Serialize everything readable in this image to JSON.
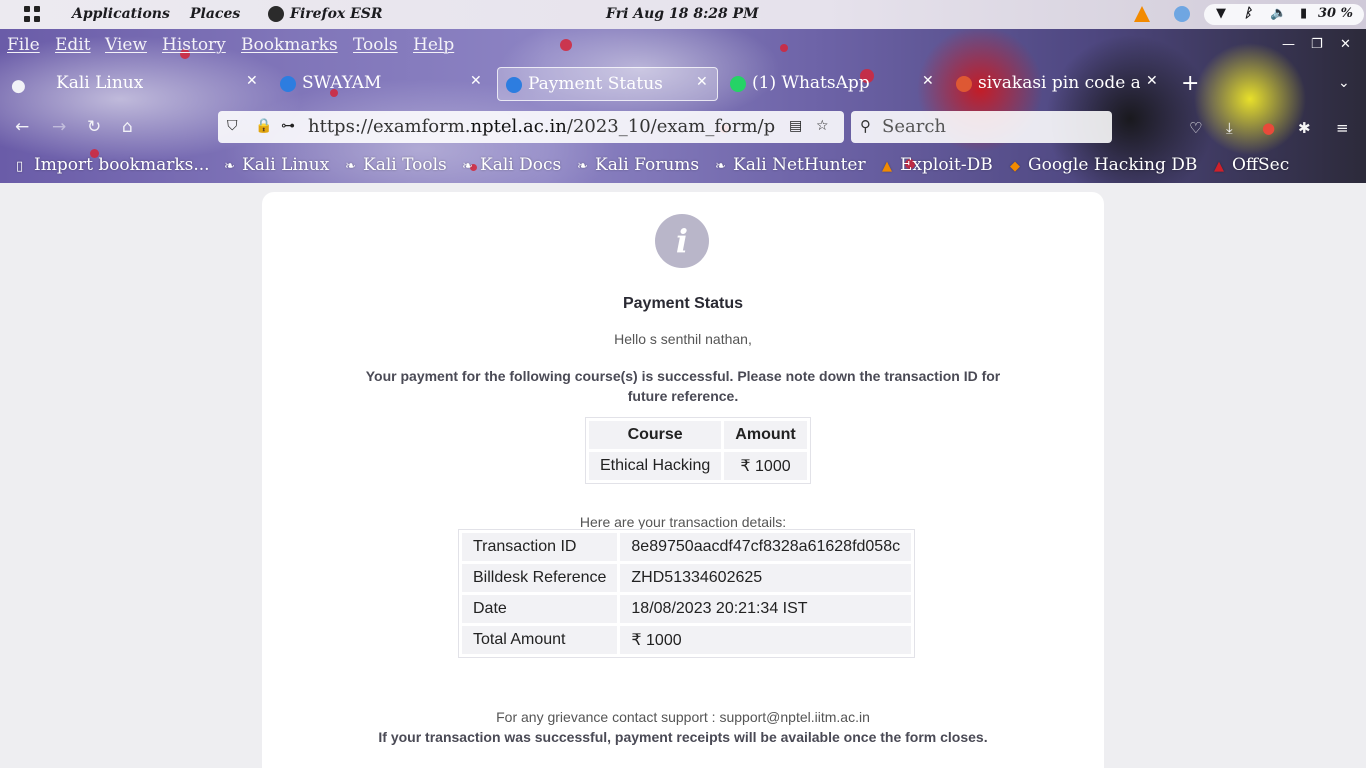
{
  "system_panel": {
    "applications": "Applications",
    "places": "Places",
    "active_app": "Firefox ESR",
    "clock": "Fri Aug 18   8:28 PM",
    "battery": "30 %"
  },
  "menu": [
    "File",
    "Edit",
    "View",
    "History",
    "Bookmarks",
    "Tools",
    "Help"
  ],
  "tabs": [
    {
      "label": "Kali Linux",
      "icon_color": "#ff7a1a"
    },
    {
      "label": "SWAYAM",
      "icon_color": "#2d7de0"
    },
    {
      "label": "Payment Status",
      "icon_color": "#2d7de0",
      "active": true
    },
    {
      "label": "(1) WhatsApp",
      "icon_color": "#25d366"
    },
    {
      "label": "sivakasi pin code a",
      "icon_color": "#de5833"
    }
  ],
  "toolbar": {
    "url_prefix": "https://examform.",
    "url_domain": "nptel.ac.in",
    "url_path": "/2023_10/exam_form/p",
    "search_placeholder": "Search"
  },
  "bookmarks": [
    "Import bookmarks...",
    "Kali Linux",
    "Kali Tools",
    "Kali Docs",
    "Kali Forums",
    "Kali NetHunter",
    "Exploit-DB",
    "Google Hacking DB",
    "OffSec"
  ],
  "page": {
    "info_glyph": "i",
    "title": "Payment Status",
    "greeting": "Hello s senthil nathan,",
    "message": "Your payment for the following course(s) is successful. Please note down the transaction ID for future reference.",
    "course_table": {
      "headers": [
        "Course",
        "Amount"
      ],
      "rows": [
        [
          "Ethical Hacking",
          "₹ 1000"
        ]
      ]
    },
    "details_intro": "Here are your transaction details:",
    "transaction": [
      [
        "Transaction ID",
        "8e89750aacdf47cf8328a61628fd058c"
      ],
      [
        "Billdesk Reference",
        "ZHD51334602625"
      ],
      [
        "Date",
        "18/08/2023 20:21:34 IST"
      ],
      [
        "Total Amount",
        "₹ 1000"
      ]
    ],
    "support": "For any grievance contact support : support@nptel.iitm.ac.in",
    "receipt_note": "If your transaction was successful, payment receipts will be available once the form closes."
  }
}
